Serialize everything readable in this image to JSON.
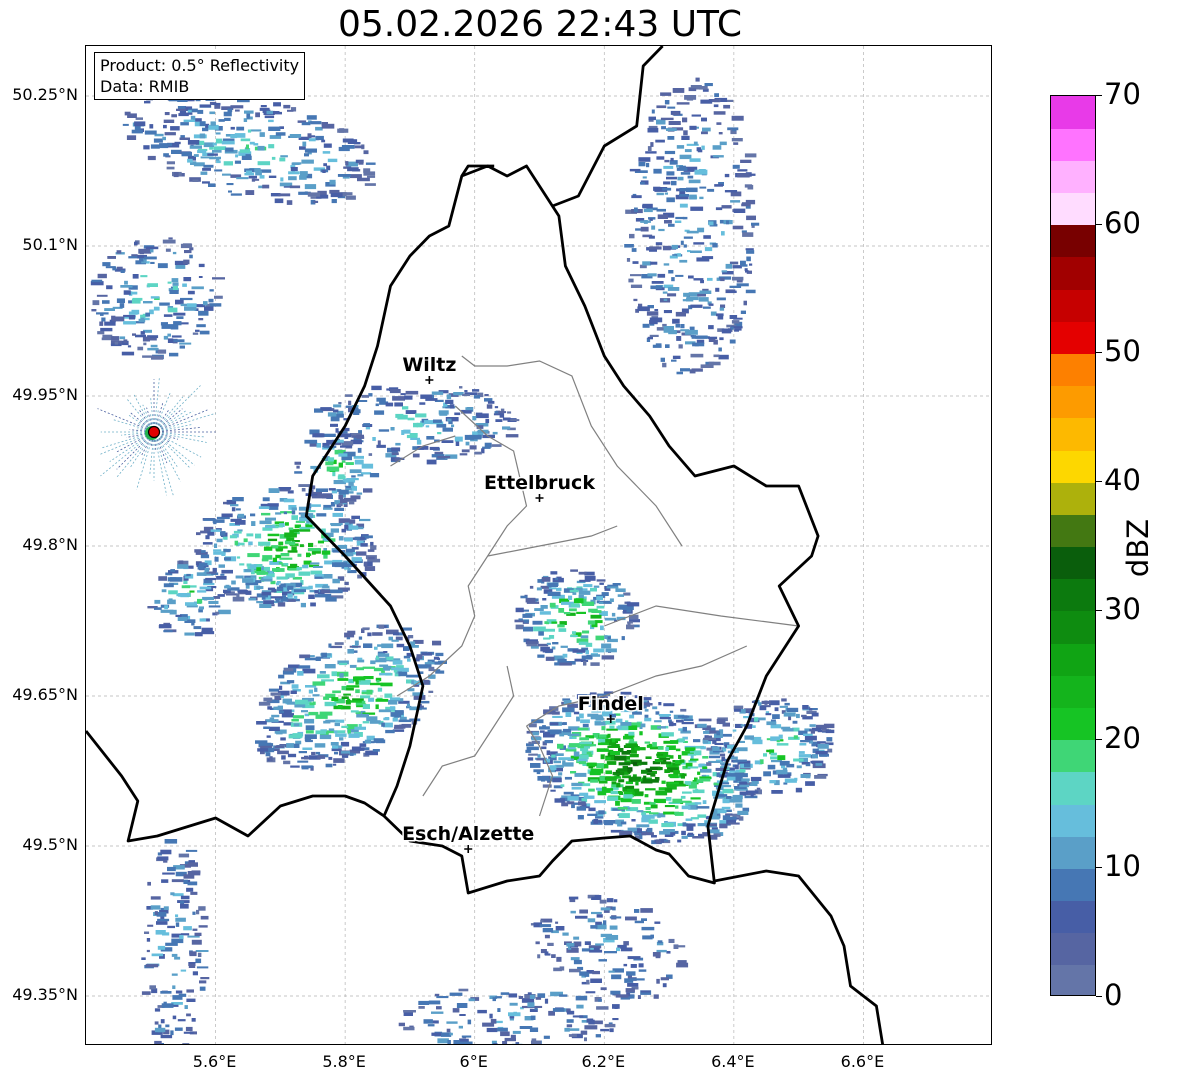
{
  "title": "05.02.2026 22:43 UTC",
  "info": {
    "line1": "Product: 0.5° Reflectivity",
    "line2": "Data: RMIB"
  },
  "axes": {
    "lon_range": [
      5.4,
      6.8
    ],
    "lat_range": [
      49.3,
      50.3
    ],
    "lat_ticks": [
      {
        "value": 50.25,
        "label": "50.25°N"
      },
      {
        "value": 50.1,
        "label": "50.1°N"
      },
      {
        "value": 49.95,
        "label": "49.95°N"
      },
      {
        "value": 49.8,
        "label": "49.8°N"
      },
      {
        "value": 49.65,
        "label": "49.65°N"
      },
      {
        "value": 49.5,
        "label": "49.5°N"
      },
      {
        "value": 49.35,
        "label": "49.35°N"
      }
    ],
    "lon_ticks": [
      {
        "value": 5.6,
        "label": "5.6°E"
      },
      {
        "value": 5.8,
        "label": "5.8°E"
      },
      {
        "value": 6.0,
        "label": "6°E"
      },
      {
        "value": 6.2,
        "label": "6.2°E"
      },
      {
        "value": 6.4,
        "label": "6.4°E"
      },
      {
        "value": 6.6,
        "label": "6.6°E"
      }
    ],
    "grid": true
  },
  "cities": [
    {
      "name": "Wiltz",
      "lon": 5.93,
      "lat": 49.966
    },
    {
      "name": "Ettelbruck",
      "lon": 6.1,
      "lat": 49.848
    },
    {
      "name": "Findel",
      "lon": 6.21,
      "lat": 49.627
    },
    {
      "name": "Esch/Alzette",
      "lon": 5.99,
      "lat": 49.497
    }
  ],
  "radar_site": {
    "lon": 5.505,
    "lat": 49.914,
    "color": "#e00000"
  },
  "colorbar": {
    "label": "dBZ",
    "min": 0,
    "max": 70,
    "step": 2.5,
    "ticks": [
      {
        "value": 0,
        "label": "0"
      },
      {
        "value": 10,
        "label": "10"
      },
      {
        "value": 20,
        "label": "20"
      },
      {
        "value": 30,
        "label": "30"
      },
      {
        "value": 40,
        "label": "40"
      },
      {
        "value": 50,
        "label": "50"
      },
      {
        "value": 60,
        "label": "60"
      },
      {
        "value": 70,
        "label": "70"
      }
    ],
    "colors": [
      "#6475a8",
      "#5665a2",
      "#475ea6",
      "#4677b4",
      "#5a9fc8",
      "#66bedc",
      "#5dd5c4",
      "#3fd676",
      "#16c424",
      "#14b41c",
      "#10a414",
      "#0e8c10",
      "#0c7a0e",
      "#0a5e0c",
      "#437812",
      "#adb10c",
      "#fdd700",
      "#fdb900",
      "#fd9b00",
      "#fd8000",
      "#e40000",
      "#c60000",
      "#a10000",
      "#780000",
      "#ffdcff",
      "#ffb1ff",
      "#ff73ff",
      "#e83ae8"
    ]
  },
  "regions": [
    {
      "lon": 6.15,
      "lat": 49.73,
      "rx": 0.09,
      "ry": 0.05,
      "intensity": 0.7,
      "angle": -5
    },
    {
      "lon": 6.25,
      "lat": 49.58,
      "rx": 0.18,
      "ry": 0.07,
      "intensity": 1.0,
      "angle": 18
    },
    {
      "lon": 6.45,
      "lat": 49.6,
      "rx": 0.1,
      "ry": 0.05,
      "intensity": 0.55,
      "angle": -5
    },
    {
      "lon": 5.7,
      "lat": 49.8,
      "rx": 0.14,
      "ry": 0.06,
      "intensity": 0.75,
      "angle": 0
    },
    {
      "lon": 5.8,
      "lat": 49.65,
      "rx": 0.16,
      "ry": 0.06,
      "intensity": 0.65,
      "angle": -28
    },
    {
      "lon": 5.65,
      "lat": 50.2,
      "rx": 0.2,
      "ry": 0.05,
      "intensity": 0.35,
      "angle": 12
    },
    {
      "lon": 5.53,
      "lat": 49.4,
      "rx": 0.05,
      "ry": 0.11,
      "intensity": 0.25,
      "angle": 0
    },
    {
      "lon": 6.2,
      "lat": 49.4,
      "rx": 0.12,
      "ry": 0.05,
      "intensity": 0.2,
      "angle": 20
    },
    {
      "lon": 5.9,
      "lat": 49.925,
      "rx": 0.16,
      "ry": 0.04,
      "intensity": 0.35,
      "angle": 0
    },
    {
      "lon": 6.05,
      "lat": 49.33,
      "rx": 0.18,
      "ry": 0.03,
      "intensity": 0.2,
      "angle": 0
    },
    {
      "lon": 6.33,
      "lat": 50.12,
      "rx": 0.1,
      "ry": 0.15,
      "intensity": 0.25,
      "angle": 0
    },
    {
      "lon": 5.5,
      "lat": 50.05,
      "rx": 0.1,
      "ry": 0.06,
      "intensity": 0.35,
      "angle": -30
    },
    {
      "lon": 5.78,
      "lat": 49.88,
      "rx": 0.06,
      "ry": 0.04,
      "intensity": 0.5,
      "angle": 0
    },
    {
      "lon": 5.55,
      "lat": 49.75,
      "rx": 0.06,
      "ry": 0.04,
      "intensity": 0.5,
      "angle": 0
    }
  ],
  "borders": {
    "country": [
      [
        [
          5.4,
          49.615
        ],
        [
          5.455,
          49.57
        ],
        [
          5.48,
          49.545
        ],
        [
          5.465,
          49.505
        ],
        [
          5.51,
          49.51
        ],
        [
          5.55,
          49.518
        ],
        [
          5.6,
          49.528
        ],
        [
          5.65,
          49.51
        ],
        [
          5.7,
          49.54
        ],
        [
          5.75,
          49.55
        ],
        [
          5.8,
          49.55
        ],
        [
          5.83,
          49.543
        ],
        [
          5.86,
          49.53
        ],
        [
          5.9,
          49.505
        ],
        [
          5.95,
          49.5
        ],
        [
          5.98,
          49.49
        ],
        [
          5.99,
          49.453
        ],
        [
          6.05,
          49.465
        ],
        [
          6.1,
          49.47
        ],
        [
          6.12,
          49.485
        ],
        [
          6.15,
          49.505
        ],
        [
          6.2,
          49.508
        ],
        [
          6.24,
          49.51
        ],
        [
          6.28,
          49.496
        ],
        [
          6.3,
          49.492
        ],
        [
          6.33,
          49.47
        ],
        [
          6.37,
          49.463
        ],
        [
          6.36,
          49.52
        ],
        [
          6.39,
          49.585
        ],
        [
          6.42,
          49.62
        ],
        [
          6.45,
          49.67
        ],
        [
          6.5,
          49.72
        ],
        [
          6.47,
          49.76
        ],
        [
          6.52,
          49.79
        ],
        [
          6.53,
          49.81
        ],
        [
          6.5,
          49.86
        ],
        [
          6.45,
          49.86
        ],
        [
          6.4,
          49.88
        ],
        [
          6.34,
          49.87
        ],
        [
          6.3,
          49.9
        ],
        [
          6.27,
          49.93
        ],
        [
          6.23,
          49.96
        ],
        [
          6.2,
          49.99
        ],
        [
          6.17,
          50.04
        ],
        [
          6.14,
          50.08
        ],
        [
          6.13,
          50.13
        ],
        [
          6.08,
          50.18
        ],
        [
          6.05,
          50.17
        ],
        [
          6.02,
          50.18
        ],
        [
          5.98,
          50.17
        ],
        [
          5.96,
          50.12
        ],
        [
          5.93,
          50.11
        ],
        [
          5.9,
          50.09
        ],
        [
          5.87,
          50.06
        ],
        [
          5.85,
          50.0
        ],
        [
          5.83,
          49.96
        ],
        [
          5.8,
          49.92
        ],
        [
          5.75,
          49.87
        ],
        [
          5.74,
          49.83
        ],
        [
          5.8,
          49.79
        ],
        [
          5.87,
          49.74
        ],
        [
          5.9,
          49.7
        ],
        [
          5.92,
          49.66
        ],
        [
          5.9,
          49.6
        ],
        [
          5.88,
          49.56
        ],
        [
          5.86,
          49.53
        ]
      ],
      [
        [
          5.98,
          50.17
        ],
        [
          5.99,
          50.18
        ],
        [
          6.03,
          50.18
        ]
      ],
      [
        [
          6.12,
          50.14
        ],
        [
          6.16,
          50.15
        ],
        [
          6.2,
          50.2
        ],
        [
          6.25,
          50.22
        ],
        [
          6.26,
          50.28
        ],
        [
          6.29,
          50.3
        ]
      ],
      [
        [
          6.37,
          49.465
        ],
        [
          6.45,
          49.475
        ],
        [
          6.5,
          49.47
        ],
        [
          6.55,
          49.43
        ],
        [
          6.57,
          49.4
        ],
        [
          6.58,
          49.36
        ],
        [
          6.6,
          49.35
        ],
        [
          6.62,
          49.34
        ],
        [
          6.63,
          49.3
        ]
      ]
    ],
    "district": [
      [
        [
          5.98,
          49.99
        ],
        [
          6.0,
          49.98
        ],
        [
          6.05,
          49.98
        ],
        [
          6.1,
          49.985
        ],
        [
          6.15,
          49.97
        ],
        [
          6.18,
          49.92
        ],
        [
          6.22,
          49.88
        ],
        [
          6.25,
          49.86
        ],
        [
          6.28,
          49.84
        ],
        [
          6.32,
          49.8
        ]
      ],
      [
        [
          5.97,
          49.94
        ],
        [
          6.02,
          49.91
        ],
        [
          6.06,
          49.895
        ],
        [
          6.08,
          49.84
        ],
        [
          6.05,
          49.82
        ],
        [
          6.02,
          49.79
        ],
        [
          5.99,
          49.76
        ],
        [
          6.0,
          49.73
        ],
        [
          5.98,
          49.7
        ],
        [
          5.93,
          49.67
        ],
        [
          5.88,
          49.65
        ]
      ],
      [
        [
          6.02,
          49.79
        ],
        [
          6.1,
          49.8
        ],
        [
          6.18,
          49.81
        ],
        [
          6.22,
          49.82
        ]
      ],
      [
        [
          6.08,
          49.62
        ],
        [
          6.13,
          49.64
        ],
        [
          6.2,
          49.65
        ],
        [
          6.28,
          49.67
        ],
        [
          6.35,
          49.68
        ],
        [
          6.42,
          49.7
        ]
      ],
      [
        [
          6.2,
          49.72
        ],
        [
          6.28,
          49.74
        ],
        [
          6.38,
          49.73
        ],
        [
          6.5,
          49.72
        ]
      ],
      [
        [
          5.92,
          49.55
        ],
        [
          5.95,
          49.58
        ],
        [
          6.0,
          49.59
        ],
        [
          6.03,
          49.62
        ],
        [
          6.06,
          49.65
        ],
        [
          6.05,
          49.68
        ]
      ],
      [
        [
          5.87,
          49.88
        ],
        [
          5.92,
          49.9
        ],
        [
          5.97,
          49.91
        ]
      ],
      [
        [
          6.1,
          49.53
        ],
        [
          6.12,
          49.57
        ],
        [
          6.1,
          49.6
        ],
        [
          6.08,
          49.62
        ]
      ]
    ]
  }
}
